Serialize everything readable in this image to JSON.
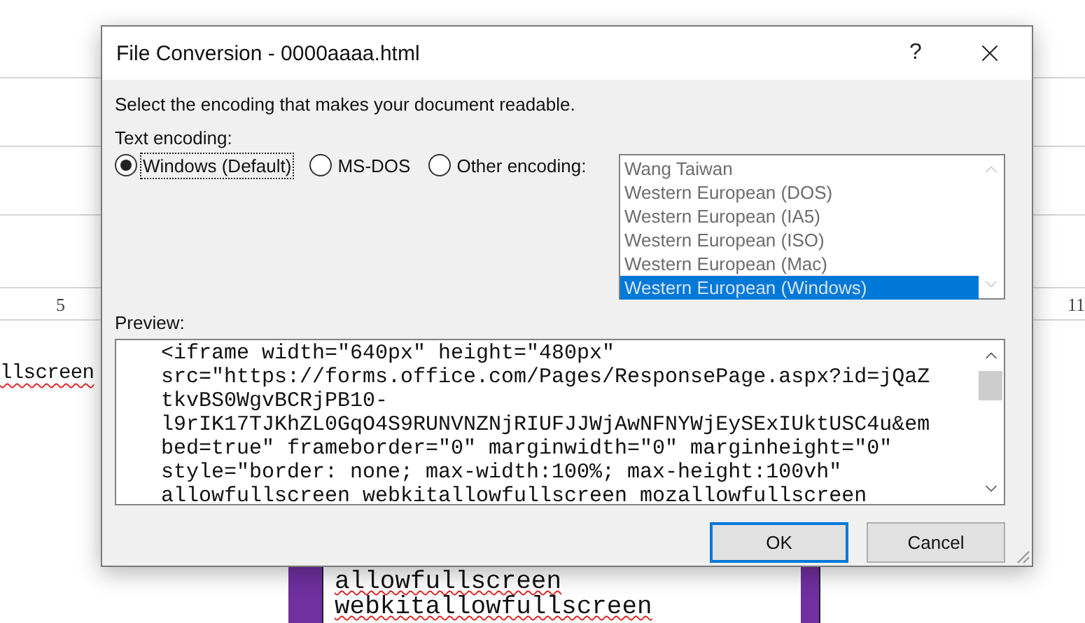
{
  "document": {
    "ruler": [
      "5",
      "11"
    ],
    "text_left": "llscreen",
    "table_lines": [
      "allowfullscreen",
      "webkitallowfullscreen"
    ]
  },
  "dialog": {
    "title": "File Conversion - 0000aaaa.html",
    "help": "?",
    "instruction": "Select the encoding that makes your document readable.",
    "encoding_label": "Text encoding:",
    "options": [
      {
        "label": "Windows (Default)",
        "selected": true
      },
      {
        "label": "MS-DOS",
        "selected": false
      },
      {
        "label": "Other encoding:",
        "selected": false
      }
    ],
    "encodings": {
      "disabled": true,
      "items": [
        {
          "label": "Wang Taiwan",
          "selected": false
        },
        {
          "label": "Western European (DOS)",
          "selected": false
        },
        {
          "label": "Western European (IA5)",
          "selected": false
        },
        {
          "label": "Western European (ISO)",
          "selected": false
        },
        {
          "label": "Western European (Mac)",
          "selected": false
        },
        {
          "label": "Western European (Windows)",
          "selected": true
        }
      ]
    },
    "preview_label": "Preview:",
    "preview_lines": [
      "<iframe width=\"640px\" height=\"480px\"",
      "src=\"https://forms.office.com/Pages/ResponsePage.aspx?id=jQaZ",
      "tkvBS0WgvBCRjPB10-",
      "l9rIK17TJKhZL0GqO4S9RUNVNZNjRIUFJJWjAwNFNYWjEySExIUktUSC4u&em",
      "bed=true\" frameborder=\"0\" marginwidth=\"0\" marginheight=\"0\"",
      "style=\"border: none; max-width:100%; max-height:100vh\"",
      "allowfullscreen webkitallowfullscreen mozallowfullscreen"
    ],
    "buttons": [
      {
        "label": "OK",
        "default": true
      },
      {
        "label": "Cancel",
        "default": false
      }
    ]
  }
}
